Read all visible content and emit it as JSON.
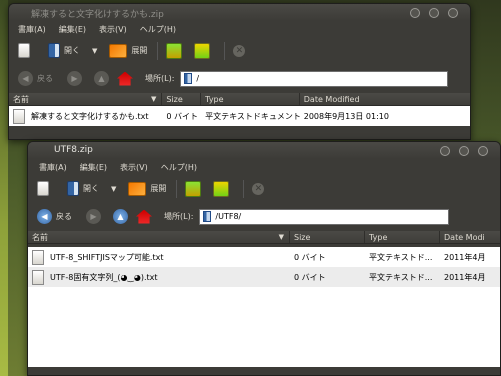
{
  "back_window": {
    "title": "解凍すると文字化けするかも.zip",
    "menu": [
      "書庫(A)",
      "編集(E)",
      "表示(V)",
      "ヘルプ(H)"
    ],
    "toolbar": {
      "open_label": "開く",
      "extract_label": "展開"
    },
    "nav": {
      "back_label": "戻る",
      "location_label": "場所(L):",
      "location_value": "/"
    },
    "columns": [
      "名前",
      "Size",
      "Type",
      "Date Modified"
    ],
    "rows": [
      {
        "name": "解凍すると文字化けするかも.txt",
        "size": "0 バイト",
        "type": "平文テキストドキュメント",
        "date": "2008年9月13日 01:10"
      }
    ]
  },
  "front_window": {
    "title": "UTF8.zip",
    "menu": [
      "書庫(A)",
      "編集(E)",
      "表示(V)",
      "ヘルプ(H)"
    ],
    "toolbar": {
      "open_label": "開く",
      "extract_label": "展開"
    },
    "nav": {
      "back_label": "戻る",
      "location_label": "場所(L):",
      "location_value": "/UTF8/"
    },
    "columns": [
      "名前",
      "Size",
      "Type",
      "Date Modi"
    ],
    "rows": [
      {
        "name": "UTF-8_SHIFTJISマップ可能.txt",
        "size": "0 バイト",
        "type": "平文テキストド...",
        "date": "2011年4月"
      },
      {
        "name": "UTF-8固有文字列_(◕‿◕).txt",
        "size": "0 バイト",
        "type": "平文テキストド...",
        "date": "2011年4月"
      }
    ]
  },
  "icons": {
    "new": "new-archive-icon",
    "open": "open-archive-icon",
    "extract": "extract-icon",
    "add_files": "add-files-icon",
    "add_folder": "add-folder-icon",
    "stop": "stop-icon",
    "back": "back-arrow-icon",
    "forward": "forward-arrow-icon",
    "up": "up-arrow-icon",
    "home": "home-icon"
  },
  "colors": {
    "window_bg": "#3c3b37",
    "title_active": "#e6e5e0",
    "title_inactive": "#8e8d88",
    "list_bg": "#ffffff",
    "row_alt": "#ececec"
  }
}
